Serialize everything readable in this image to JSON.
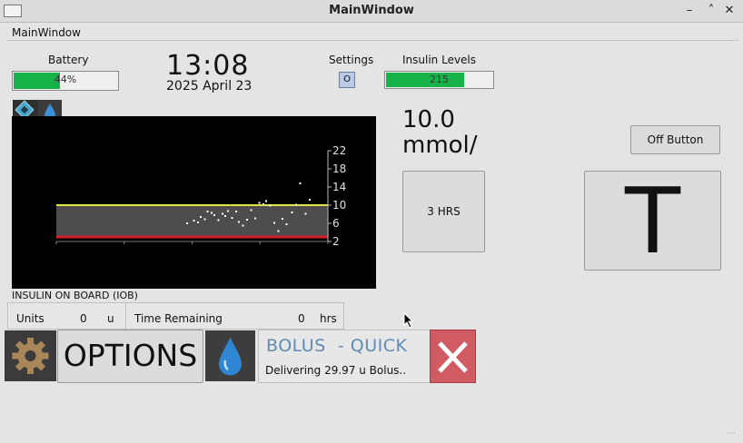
{
  "window": {
    "title": "MainWindow",
    "menubar_label": "MainWindow",
    "minimize": "–",
    "maximize": "˄",
    "close": "✕"
  },
  "battery": {
    "label": "Battery",
    "percent_text": "44%",
    "level": 0.44
  },
  "clock": {
    "time": "13:08",
    "date": "2025 April 23"
  },
  "settings": {
    "label": "Settings",
    "button_text": "O"
  },
  "insulin": {
    "label": "Insulin Levels",
    "value_text": "215",
    "level": 0.72
  },
  "glucose": {
    "value": "10.0",
    "unit": "mmol/"
  },
  "buttons": {
    "hrs": "3 HRS",
    "off": "Off Button",
    "t": "T",
    "options": "OPTIONS"
  },
  "graph": {
    "y_ticks": [
      "22",
      "18",
      "14",
      "10",
      "6",
      "2"
    ],
    "colors": {
      "high_line": "#e8e04a",
      "low_line": "#d21f2a",
      "band": "#4d4d4d",
      "points": "#ffffff"
    }
  },
  "chart_data": {
    "type": "scatter",
    "ylim": [
      2,
      22
    ],
    "y_ticks": [
      22,
      18,
      14,
      10,
      6,
      2
    ],
    "target_range": [
      3,
      10
    ],
    "points": [
      [
        0.0,
        6.0
      ],
      [
        0.05,
        6.6
      ],
      [
        0.08,
        6.2
      ],
      [
        0.1,
        7.4
      ],
      [
        0.13,
        6.9
      ],
      [
        0.15,
        8.6
      ],
      [
        0.18,
        8.3
      ],
      [
        0.2,
        7.8
      ],
      [
        0.23,
        6.7
      ],
      [
        0.26,
        8.1
      ],
      [
        0.28,
        7.6
      ],
      [
        0.3,
        8.7
      ],
      [
        0.33,
        7.2
      ],
      [
        0.36,
        8.6
      ],
      [
        0.38,
        6.3
      ],
      [
        0.41,
        5.5
      ],
      [
        0.44,
        6.8
      ],
      [
        0.47,
        8.9
      ],
      [
        0.5,
        7.1
      ],
      [
        0.53,
        10.5
      ],
      [
        0.56,
        10.2
      ],
      [
        0.58,
        10.9
      ],
      [
        0.61,
        9.9
      ],
      [
        0.64,
        6.1
      ],
      [
        0.67,
        4.3
      ],
      [
        0.7,
        7.0
      ],
      [
        0.73,
        5.8
      ],
      [
        0.77,
        8.4
      ],
      [
        0.8,
        10.1
      ],
      [
        0.83,
        14.8
      ],
      [
        0.87,
        8.1
      ],
      [
        0.9,
        11.2
      ]
    ]
  },
  "iob": {
    "label": "INSULIN ON BOARD (IOB)",
    "units_label": "Units",
    "units_value": "0",
    "units_unit": "u",
    "time_label": "Time Remaining",
    "time_value": "0",
    "time_unit": "hrs"
  },
  "bolus": {
    "title": "BOLUS  - QUICK",
    "status": "Delivering 29.97 u Bolus.."
  }
}
